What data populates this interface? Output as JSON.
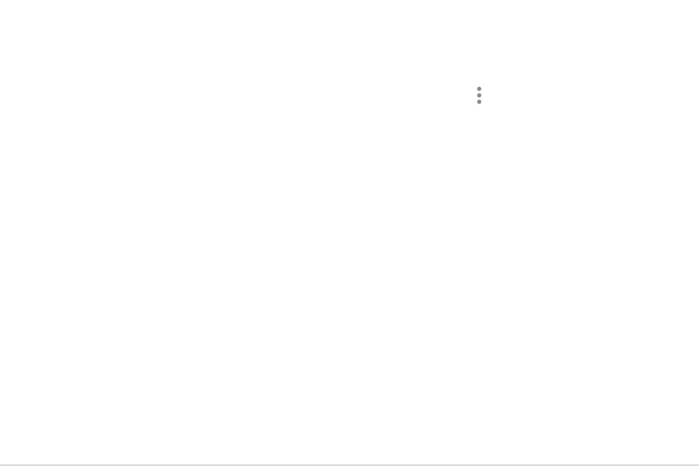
{
  "toolbar": {
    "more_options_icon": "more-vert-icon",
    "icon_color": "#8a8a8a"
  },
  "colors": {
    "background": "#ffffff",
    "bottom_edge": "#d9d9d9"
  }
}
